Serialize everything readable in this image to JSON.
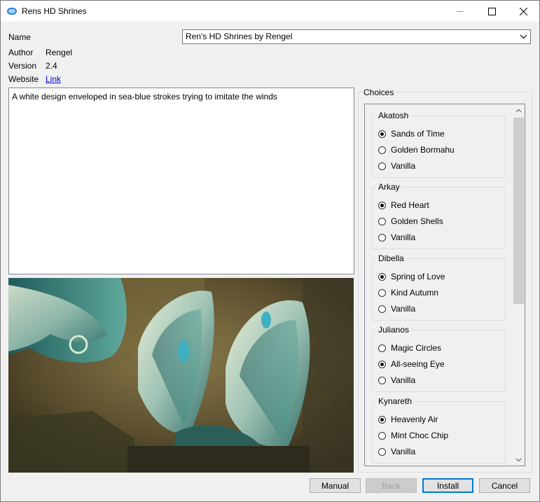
{
  "window": {
    "title": "Rens HD Shrines"
  },
  "info": {
    "name_label": "Name",
    "name_value": "Ren's HD Shrines by Rengel",
    "author_label": "Author",
    "author_value": "Rengel",
    "version_label": "Version",
    "version_value": "2.4",
    "website_label": "Website",
    "website_link": "Link"
  },
  "description": "A white design enveloped in sea-blue strokes trying to imitate the winds",
  "choices": {
    "title": "Choices",
    "groups": [
      {
        "name": "Akatosh",
        "options": [
          {
            "label": "Sands of Time",
            "checked": true
          },
          {
            "label": "Golden Bormahu",
            "checked": false
          },
          {
            "label": "Vanilla",
            "checked": false
          }
        ]
      },
      {
        "name": "Arkay",
        "options": [
          {
            "label": "Red Heart",
            "checked": true
          },
          {
            "label": "Golden Shells",
            "checked": false
          },
          {
            "label": "Vanilla",
            "checked": false
          }
        ]
      },
      {
        "name": "Dibella",
        "options": [
          {
            "label": "Spring of Love",
            "checked": true
          },
          {
            "label": "Kind Autumn",
            "checked": false
          },
          {
            "label": "Vanilla",
            "checked": false
          }
        ]
      },
      {
        "name": "Julianos",
        "options": [
          {
            "label": "Magic Circles",
            "checked": false
          },
          {
            "label": "All-seeing Eye",
            "checked": true
          },
          {
            "label": "Vanilla",
            "checked": false
          }
        ]
      },
      {
        "name": "Kynareth",
        "options": [
          {
            "label": "Heavenly Air",
            "checked": true
          },
          {
            "label": "Mint Choc Chip",
            "checked": false
          },
          {
            "label": "Vanilla",
            "checked": false
          }
        ]
      }
    ]
  },
  "buttons": {
    "manual": "Manual",
    "back": "Back",
    "install": "Install",
    "cancel": "Cancel"
  }
}
